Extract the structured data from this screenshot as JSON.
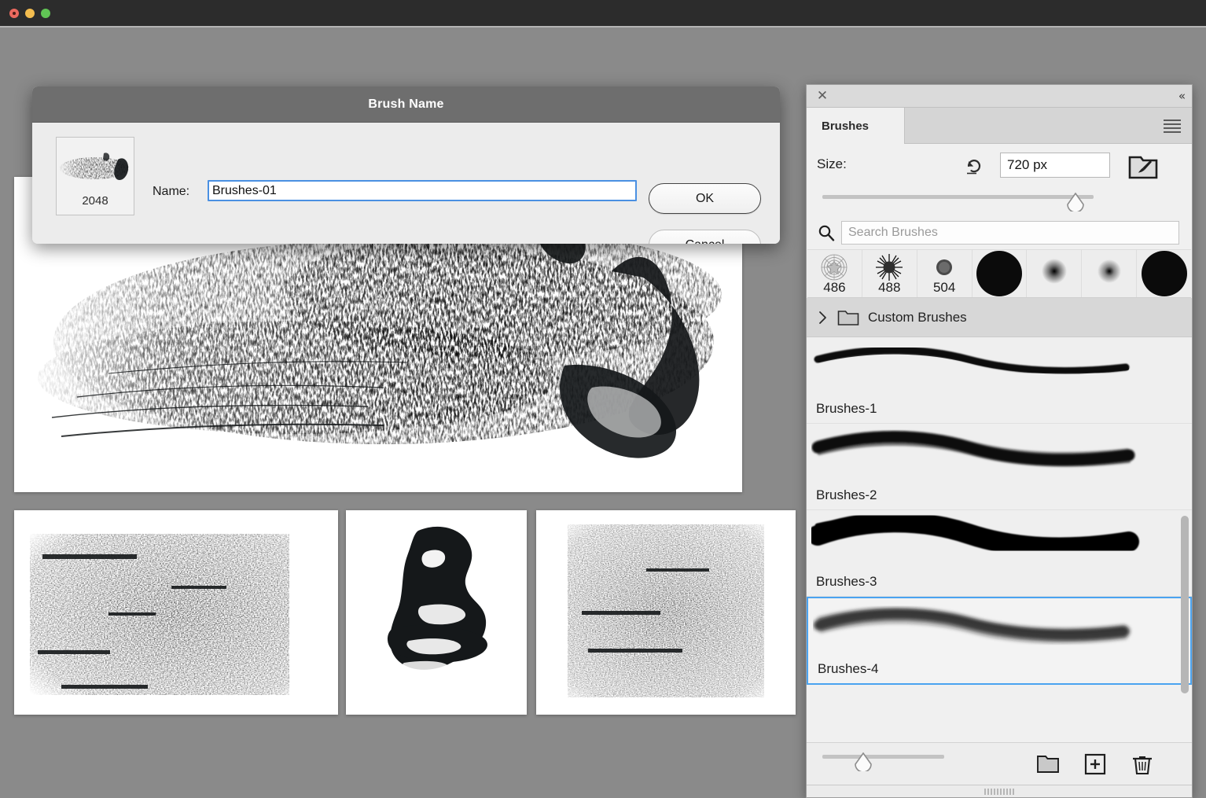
{
  "window": {
    "traffic_lights": [
      "close",
      "minimize",
      "maximize"
    ],
    "background_color": "#8a8a8a",
    "titlebar_color": "#2c2c2c"
  },
  "dialog": {
    "title": "Brush Name",
    "thumbnail_size_label": "2048",
    "name_label": "Name:",
    "name_value": "Brushes-01",
    "ok_label": "OK",
    "cancel_label": "Cancel",
    "focus_border_color": "#4a90e2"
  },
  "panel": {
    "close_icon": "close-icon",
    "collapse_icon": "«",
    "tab_label": "Brushes",
    "menu_icon": "hamburger-menu-icon",
    "size": {
      "label": "Size:",
      "value": "720 px",
      "reset_icon": "reset-arrow-icon",
      "folder_brush_icon": "brush-preset-folder-icon",
      "slider_percent": 97
    },
    "search": {
      "placeholder": "Search Brushes",
      "value": "",
      "icon": "search-icon"
    },
    "presets": [
      {
        "label": "486",
        "type": "scatter-star"
      },
      {
        "label": "488",
        "type": "spiky-burst"
      },
      {
        "label": "504",
        "type": "small-round"
      },
      {
        "label": "",
        "type": "hard-round-large"
      },
      {
        "label": "",
        "type": "soft-round-small"
      },
      {
        "label": "",
        "type": "soft-round-tiny"
      },
      {
        "label": "",
        "type": "hard-round-xl"
      }
    ],
    "folder_group": {
      "label": "Custom Brushes",
      "expanded": false,
      "chevron_icon": "chevron-right-icon",
      "folder_icon": "folder-icon"
    },
    "brush_items": [
      {
        "label": "Brushes-1",
        "selected": false,
        "stroke": "thin-tapered"
      },
      {
        "label": "Brushes-2",
        "selected": false,
        "stroke": "medium-textured"
      },
      {
        "label": "Brushes-3",
        "selected": false,
        "stroke": "thick-solid"
      },
      {
        "label": "Brushes-4",
        "selected": true,
        "stroke": "soft-wispy"
      }
    ],
    "selection_color": "#4aa3f0",
    "footer": {
      "slider_percent": 30,
      "new_folder_icon": "new-folder-icon",
      "new_brush_icon": "new-brush-icon",
      "delete_icon": "trash-icon"
    },
    "scrollbar": {
      "thumb_top_percent": 44,
      "thumb_height_percent": 44
    },
    "resize_grip_icon": "resize-grip-icon"
  },
  "documents": [
    {
      "name": "document-main",
      "kind": "brush-stroke-splatter"
    },
    {
      "name": "document-thumb-1",
      "kind": "brush-stroke-dry-block"
    },
    {
      "name": "document-thumb-2",
      "kind": "brush-stroke-heavy-blot"
    },
    {
      "name": "document-thumb-3",
      "kind": "brush-stroke-dry-block"
    }
  ]
}
